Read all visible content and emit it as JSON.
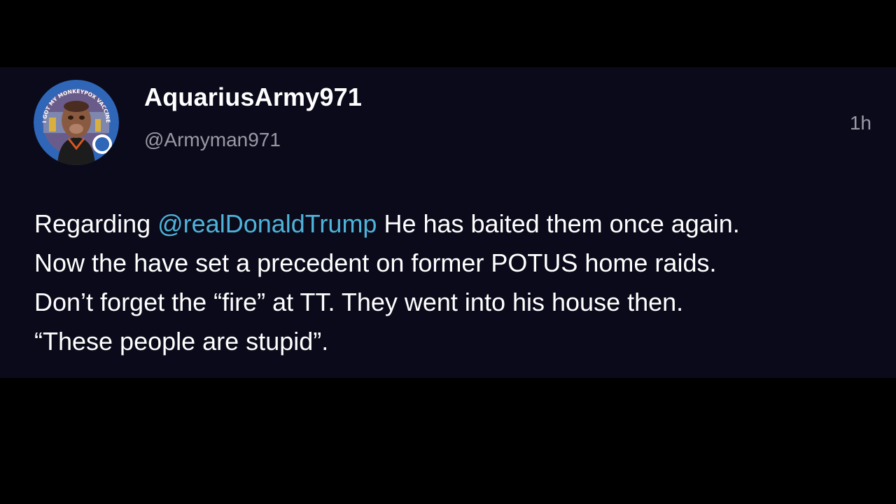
{
  "post": {
    "display_name": "AquariusArmy971",
    "handle": "@Armyman971",
    "timestamp": "1h",
    "avatar": {
      "badge_text": "I GOT MY MONKEYPOX VACCINE",
      "icon": "avatar-image"
    },
    "body": {
      "prefix": "Regarding ",
      "mention": "@realDonaldTrump",
      "line1_rest": " He has baited them once again.",
      "line2": "Now the have set a precedent on former POTUS home raids.",
      "line3": "Don’t forget the “fire” at TT. They went into his house then.",
      "line4": "“These people are stupid”."
    }
  },
  "colors": {
    "page_background": "#000000",
    "card_background": "#0a0a1a",
    "text_primary": "#ffffff",
    "text_secondary": "#9a9aa6",
    "mention": "#4fb3d9"
  }
}
